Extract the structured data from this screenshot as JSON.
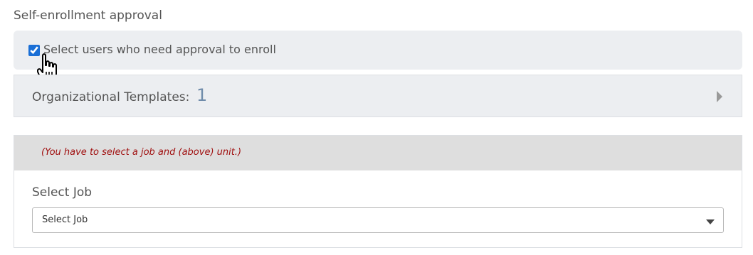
{
  "self_enrollment": {
    "title": "Self-enrollment approval",
    "checkbox_label": "Select users who need approval to enroll",
    "checkbox_checked": true
  },
  "org_templates": {
    "label": "Organizational Templates:",
    "count": "1",
    "expand_icon": "caret-right-icon"
  },
  "job_section": {
    "warning": "(You have to select a job and (above) unit.)",
    "label": "Select Job",
    "select_value": "Select Job",
    "select_icon": "caret-down-icon"
  },
  "colors": {
    "accent": "#1a6fd6",
    "warning_text": "#a01010",
    "count_text": "#6f8baa",
    "panel_bg": "#eceef1"
  }
}
